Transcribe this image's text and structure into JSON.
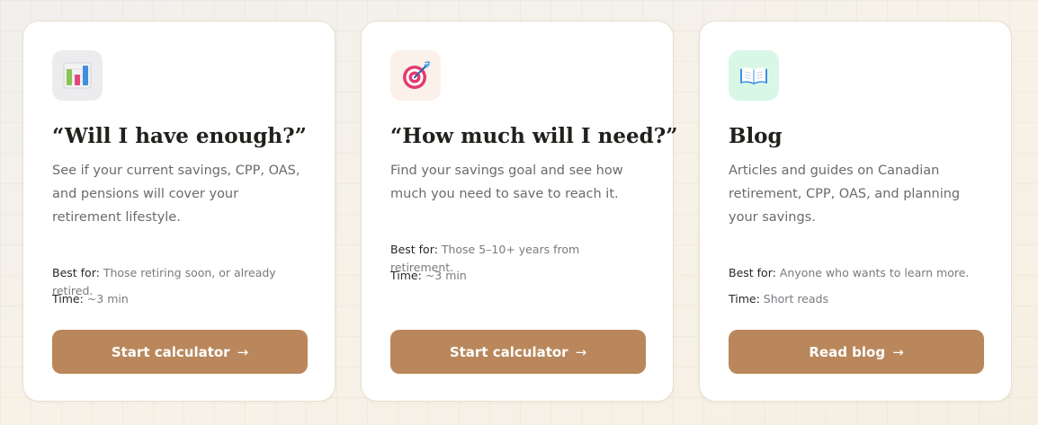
{
  "cards": [
    {
      "icon": "bar-chart-icon",
      "icon_bg": "#ececee",
      "title": "“Will I have enough?”",
      "description": "See if your current savings, CPP, OAS, and pensions will cover your retirement lifestyle.",
      "best_for_label": "Best for:",
      "best_for_value": "Those retiring soon, or already retired.",
      "time_label": "Time:",
      "time_value": "~3 min",
      "button_label": "Start calculator",
      "button_arrow": "→"
    },
    {
      "icon": "target-icon",
      "icon_bg": "#fbf1ea",
      "title": "“How much will I need?”",
      "description": "Find your savings goal and see how much you need to save to reach it.",
      "best_for_label": "Best for:",
      "best_for_value": "Those 5–10+ years from retirement.",
      "time_label": "Time:",
      "time_value": "~3 min",
      "button_label": "Start calculator",
      "button_arrow": "→"
    },
    {
      "icon": "open-book-icon",
      "icon_bg": "#d9f7e6",
      "title": "Blog",
      "description": "Articles and guides on Canadian retirement, CPP, OAS, and planning your savings.",
      "best_for_label": "Best for:",
      "best_for_value": "Anyone who wants to learn more.",
      "time_label": "Time:",
      "time_value": "Short reads",
      "button_label": "Read blog",
      "button_arrow": "→"
    }
  ],
  "colors": {
    "button": "#b9875b",
    "title": "#22201d",
    "body_text": "#6c6a6c",
    "card_border": "#e8dfcf"
  }
}
